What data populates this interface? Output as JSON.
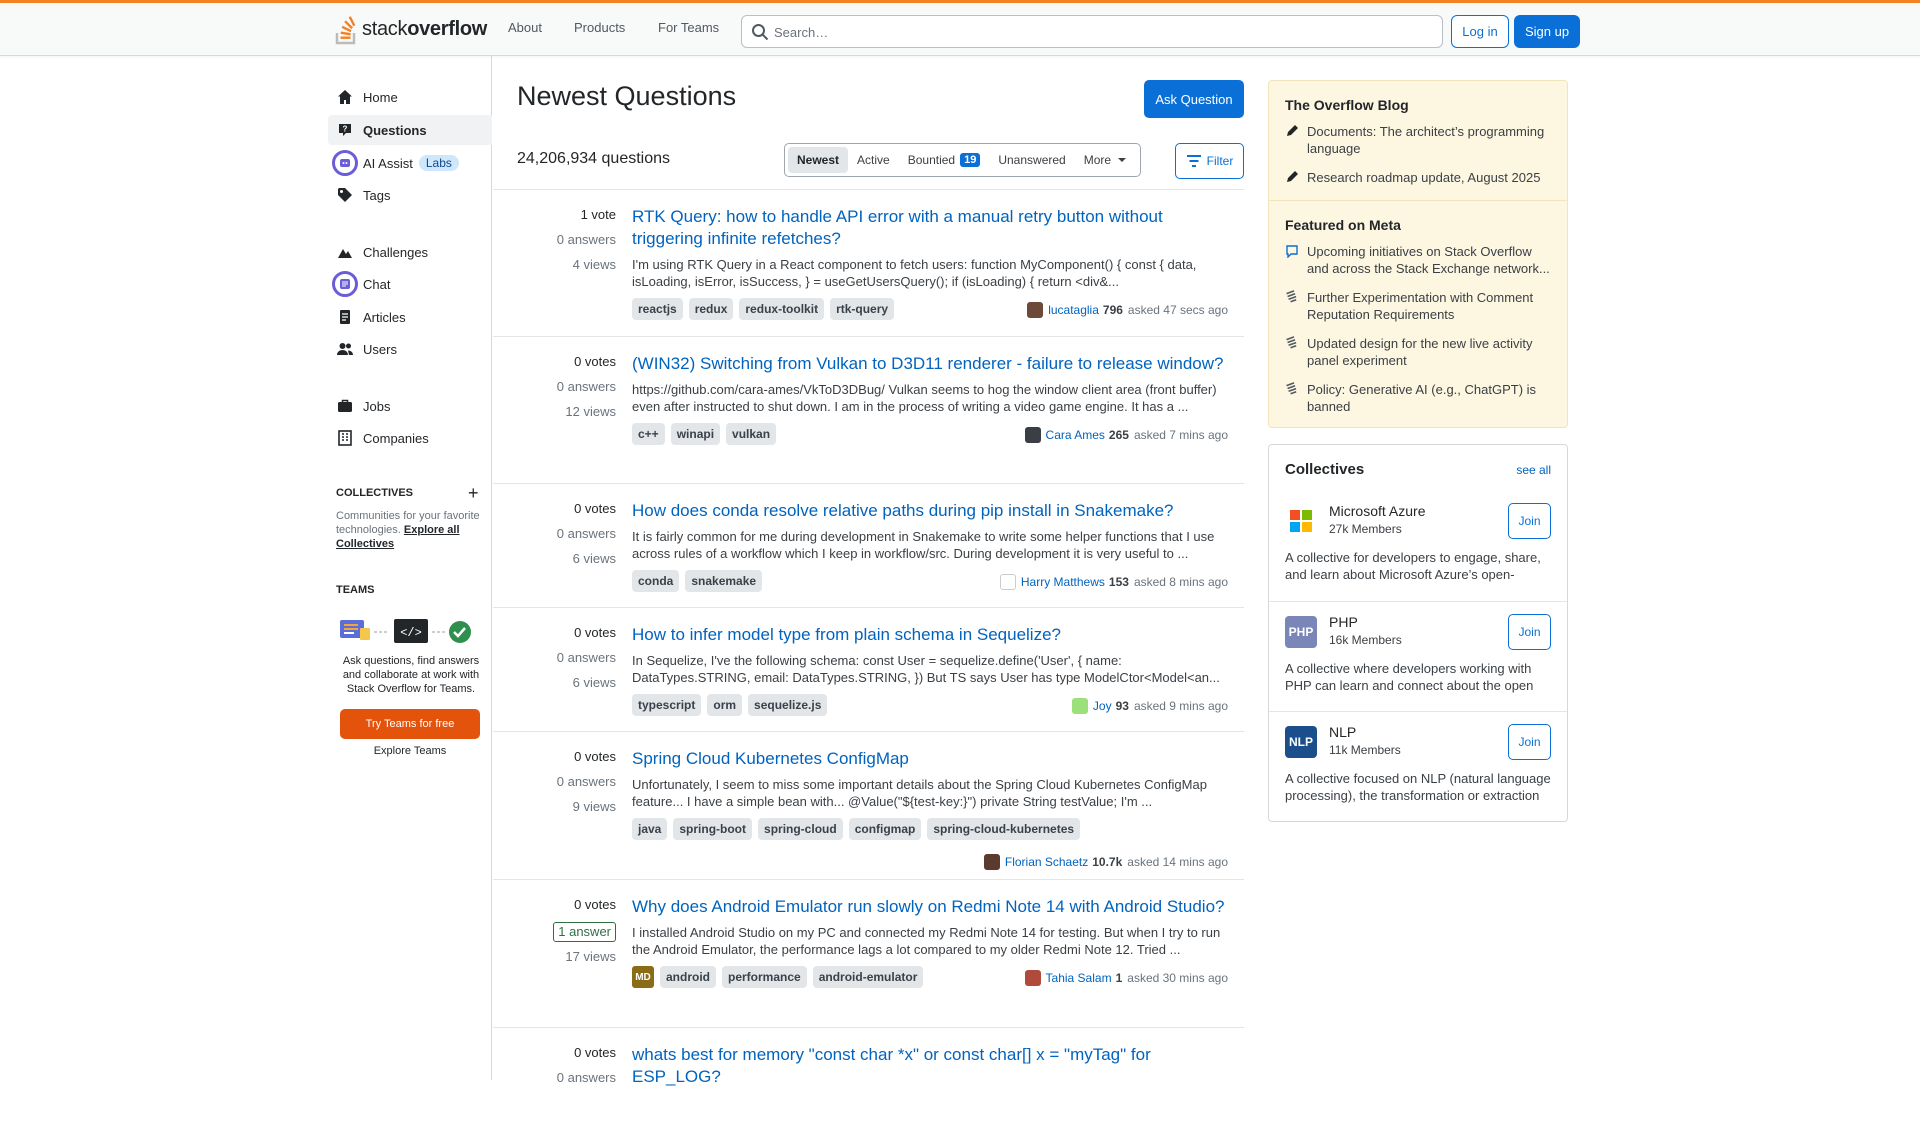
{
  "header": {
    "logo_text_plain": "stack",
    "logo_text_bold": "overflow",
    "nav": [
      "About",
      "Products",
      "For Teams"
    ],
    "search_placeholder": "Search…",
    "login_label": "Log in",
    "signup_label": "Sign up",
    "accent_color": "#f48225"
  },
  "sidebar": {
    "items": [
      {
        "label": "Home",
        "icon": "home-icon"
      },
      {
        "label": "Questions",
        "icon": "questions-icon",
        "active": true
      },
      {
        "label": "AI Assist",
        "icon": "ai-assist-icon",
        "badge": "Labs"
      },
      {
        "label": "Tags",
        "icon": "tag-icon"
      },
      {
        "label": "Challenges",
        "icon": "challenges-icon"
      },
      {
        "label": "Chat",
        "icon": "chat-icon"
      },
      {
        "label": "Articles",
        "icon": "articles-icon"
      },
      {
        "label": "Users",
        "icon": "users-icon"
      },
      {
        "label": "Jobs",
        "icon": "briefcase-icon"
      },
      {
        "label": "Companies",
        "icon": "building-icon"
      }
    ],
    "collectives_title": "COLLECTIVES",
    "collectives_desc": "Communities for your favorite technologies.",
    "collectives_link": "Explore all Collectives",
    "teams_title": "TEAMS",
    "teams_desc": "Ask questions, find answers and collaborate at work with Stack Overflow for Teams.",
    "teams_button": "Try Teams for free",
    "teams_explore": "Explore Teams"
  },
  "main": {
    "title": "Newest Questions",
    "ask_button": "Ask Question",
    "question_count": "24,206,934 questions",
    "tabs": [
      {
        "label": "Newest",
        "active": true
      },
      {
        "label": "Active"
      },
      {
        "label": "Bountied",
        "badge": "19"
      },
      {
        "label": "Unanswered"
      },
      {
        "label": "More"
      }
    ],
    "filter_label": "Filter",
    "questions": [
      {
        "votes": "1 vote",
        "answers": "0 answers",
        "views": "4 views",
        "title": "RTK Query: how to handle API error with a manual retry button without triggering infinite refetches?",
        "excerpt": "I'm using RTK Query in a React component to fetch users: function MyComponent() { const { data, isLoading, isError, isSuccess, } = useGetUsersQuery(); if (isLoading) { return <div&...",
        "tags": [
          "reactjs",
          "redux",
          "redux-toolkit",
          "rtk-query"
        ],
        "user": "lucataglia",
        "rep": "796",
        "time": "asked 47 secs ago",
        "avatar_color": "#6b4a3a"
      },
      {
        "votes": "0 votes",
        "answers": "0 answers",
        "views": "12 views",
        "title": "(WIN32) Switching from Vulkan to D3D11 renderer - failure to release window?",
        "excerpt": "https://github.com/cara-ames/VkToD3DBug/ Vulkan seems to hog the window client area (front buffer) even after instructed to shut down. I am in the process of writing a video game engine. It has a ...",
        "tags": [
          "c++",
          "winapi",
          "vulkan"
        ],
        "user": "Cara Ames",
        "rep": "265",
        "time": "asked 7 mins ago",
        "avatar_color": "#3a3f45"
      },
      {
        "votes": "0 votes",
        "answers": "0 answers",
        "views": "6 views",
        "title": "How does conda resolve relative paths during pip install in Snakemake?",
        "excerpt": "It is fairly common for me during development in Snakemake to write some helper functions that I use across rules of a workflow which I keep in workflow/src. During development it is very useful to ...",
        "tags": [
          "conda",
          "snakemake"
        ],
        "user": "Harry Matthews",
        "rep": "153",
        "time": "asked 8 mins ago",
        "avatar_color": "#c8ccd0"
      },
      {
        "votes": "0 votes",
        "answers": "0 answers",
        "views": "6 views",
        "title": "How to infer model type from plain schema in Sequelize?",
        "excerpt": "In Sequelize, I've the following schema: const User = sequelize.define('User', { name: DataTypes.STRING, email: DataTypes.STRING, }) But TS says User has type ModelCtor<Model<an...",
        "tags": [
          "typescript",
          "orm",
          "sequelize.js"
        ],
        "user": "Joy",
        "rep": "93",
        "time": "asked 9 mins ago",
        "avatar_color": "#9be07a"
      },
      {
        "votes": "0 votes",
        "answers": "0 answers",
        "views": "9 views",
        "title": "Spring Cloud Kubernetes ConfigMap",
        "excerpt": "Unfortunately, I seem to miss some important details about the Spring Cloud Kubernetes ConfigMap feature... I have a simple bean with... @Value(\"${test-key:}\") private String testValue; I'm ...",
        "tags": [
          "java",
          "spring-boot",
          "spring-cloud",
          "configmap",
          "spring-cloud-kubernetes"
        ],
        "user": "Florian Schaetz",
        "rep": "10.7k",
        "time": "asked 14 mins ago",
        "avatar_color": "#5a3b2e"
      },
      {
        "votes": "0 votes",
        "answers": "1 answer",
        "views": "17 views",
        "title": "Why does Android Emulator run slowly on Redmi Note 14 with Android Studio?",
        "excerpt": "I installed Android Studio on my PC and connected my Redmi Note 14 for testing. But when I try to run the Android Emulator, the performance lags a lot compared to my older Redmi Note 12. Tried ...",
        "prefix_badge": "MD",
        "tags": [
          "android",
          "performance",
          "android-emulator"
        ],
        "user": "Tahia Salam",
        "rep": "1",
        "time": "asked 30 mins ago",
        "avatar_color": "#b04a3a"
      },
      {
        "votes": "0 votes",
        "answers": "0 answers",
        "views": "",
        "title": "whats best for memory \"const char *x\" or const char[] x = \"myTag\" for ESP_LOG?",
        "excerpt": "",
        "tags": [],
        "user": "",
        "rep": "",
        "time": "",
        "avatar_color": ""
      }
    ]
  },
  "right": {
    "blog_title": "The Overflow Blog",
    "blog_items": [
      "Documents: The architect’s programming language",
      "Research roadmap update, August 2025"
    ],
    "meta_title": "Featured on Meta",
    "meta_items": [
      {
        "text": "Upcoming initiatives on Stack Overflow and across the Stack Exchange network...",
        "icon": "chat-bubble-icon"
      },
      {
        "text": "Further Experimentation with Comment Reputation Requirements",
        "icon": "stack-exchange-icon"
      },
      {
        "text": "Updated design for the new live activity panel experiment",
        "icon": "stack-exchange-icon"
      },
      {
        "text": "Policy: Generative AI (e.g., ChatGPT) is banned",
        "icon": "stack-exchange-icon"
      }
    ],
    "collectives_title": "Collectives",
    "collectives_see_all": "see all",
    "collectives": [
      {
        "name": "Microsoft Azure",
        "members": "27k Members",
        "join": "Join",
        "desc": "A collective for developers to engage, share, and learn about Microsoft Azure’s open-source frameworks, languages, and platform.",
        "logo": "microsoft-logo"
      },
      {
        "name": "PHP",
        "members": "16k Members",
        "join": "Join",
        "desc": "A collective where developers working with PHP can learn and connect about the open source scripting language.",
        "logo_text": "PHP",
        "logo_color": "#7a86b8"
      },
      {
        "name": "NLP",
        "members": "11k Members",
        "join": "Join",
        "desc": "A collective focused on NLP (natural language processing), the transformation or extraction of useful information from natural language data.",
        "logo_text": "NLP",
        "logo_color": "#1b4f8c"
      }
    ]
  }
}
